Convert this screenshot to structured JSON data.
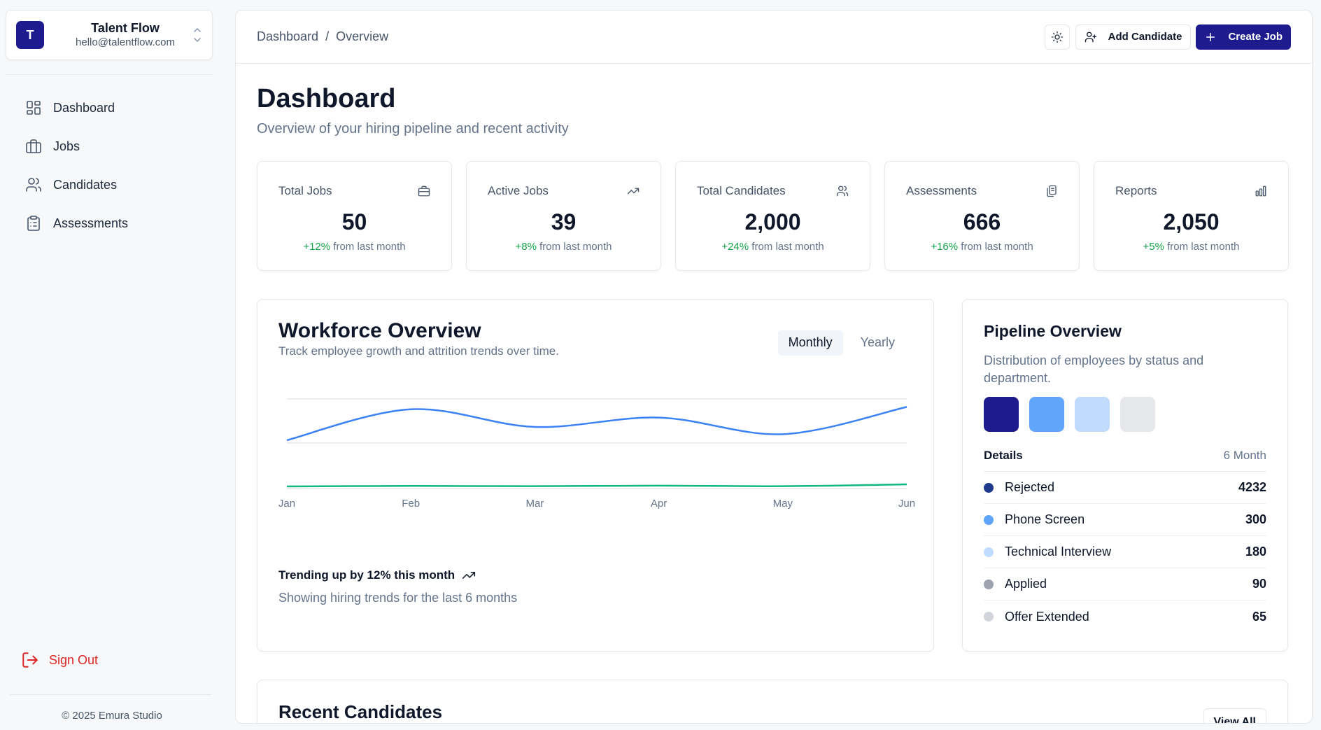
{
  "org": {
    "initial": "T",
    "name": "Talent Flow",
    "email": "hello@talentflow.com"
  },
  "nav": [
    {
      "label": "Dashboard",
      "icon": "dashboard-icon"
    },
    {
      "label": "Jobs",
      "icon": "briefcase-icon"
    },
    {
      "label": "Candidates",
      "icon": "users-icon"
    },
    {
      "label": "Assessments",
      "icon": "clipboard-icon"
    }
  ],
  "sidebar": {
    "signout_label": "Sign Out",
    "copyright": "© 2025 Emura Studio"
  },
  "breadcrumb": {
    "root": "Dashboard",
    "sep": "/",
    "current": "Overview"
  },
  "actions": {
    "add_candidate": "Add Candidate",
    "create_job": "Create Job"
  },
  "page": {
    "title": "Dashboard",
    "subtitle": "Overview of your hiring pipeline and recent activity"
  },
  "stats": [
    {
      "label": "Total Jobs",
      "value": "50",
      "change": "+12%",
      "suffix": "from last month",
      "icon": "briefcase-icon"
    },
    {
      "label": "Active Jobs",
      "value": "39",
      "change": "+8%",
      "suffix": "from last month",
      "icon": "trending-up-icon"
    },
    {
      "label": "Total Candidates",
      "value": "2,000",
      "change": "+24%",
      "suffix": "from last month",
      "icon": "users-icon"
    },
    {
      "label": "Assessments",
      "value": "666",
      "change": "+16%",
      "suffix": "from last month",
      "icon": "copy-icon"
    },
    {
      "label": "Reports",
      "value": "2,050",
      "change": "+5%",
      "suffix": "from last month",
      "icon": "bar-chart-icon"
    }
  ],
  "workforce": {
    "title": "Workforce Overview",
    "subtitle": "Track employee growth and attrition trends over time.",
    "toggle": {
      "monthly": "Monthly",
      "yearly": "Yearly",
      "selected": "Monthly"
    },
    "trend_text": "Trending up by 12% this month",
    "trend_sub": "Showing hiring trends for the last 6 months"
  },
  "chart_data": {
    "type": "line",
    "categories": [
      "Jan",
      "Feb",
      "Mar",
      "Apr",
      "May",
      "Jun"
    ],
    "series": [
      {
        "values": [
          186,
          305,
          237,
          273,
          209,
          314
        ],
        "color": "#3b82f6"
      },
      {
        "values": [
          8,
          10,
          9,
          11,
          9,
          16
        ],
        "color": "#10b981"
      }
    ],
    "ylim": [
      0,
      350
    ],
    "grid": true,
    "legend": "none"
  },
  "pipeline": {
    "title": "Pipeline Overview",
    "subtitle": "Distribution of employees by status and department.",
    "swatches": [
      "#1e1b8f",
      "#60a5fa",
      "#bfdbfe",
      "#e5e7eb"
    ],
    "details_label": "Details",
    "period": "6 Month",
    "rows": [
      {
        "label": "Rejected",
        "value": "4232",
        "color": "#1e3a8a"
      },
      {
        "label": "Phone Screen",
        "value": "300",
        "color": "#60a5fa"
      },
      {
        "label": "Technical Interview",
        "value": "180",
        "color": "#bfdbfe"
      },
      {
        "label": "Applied",
        "value": "90",
        "color": "#9ca3af"
      },
      {
        "label": "Offer Extended",
        "value": "65",
        "color": "#d1d5db"
      }
    ]
  },
  "recent": {
    "title": "Recent Candidates",
    "view_all": "View All"
  }
}
